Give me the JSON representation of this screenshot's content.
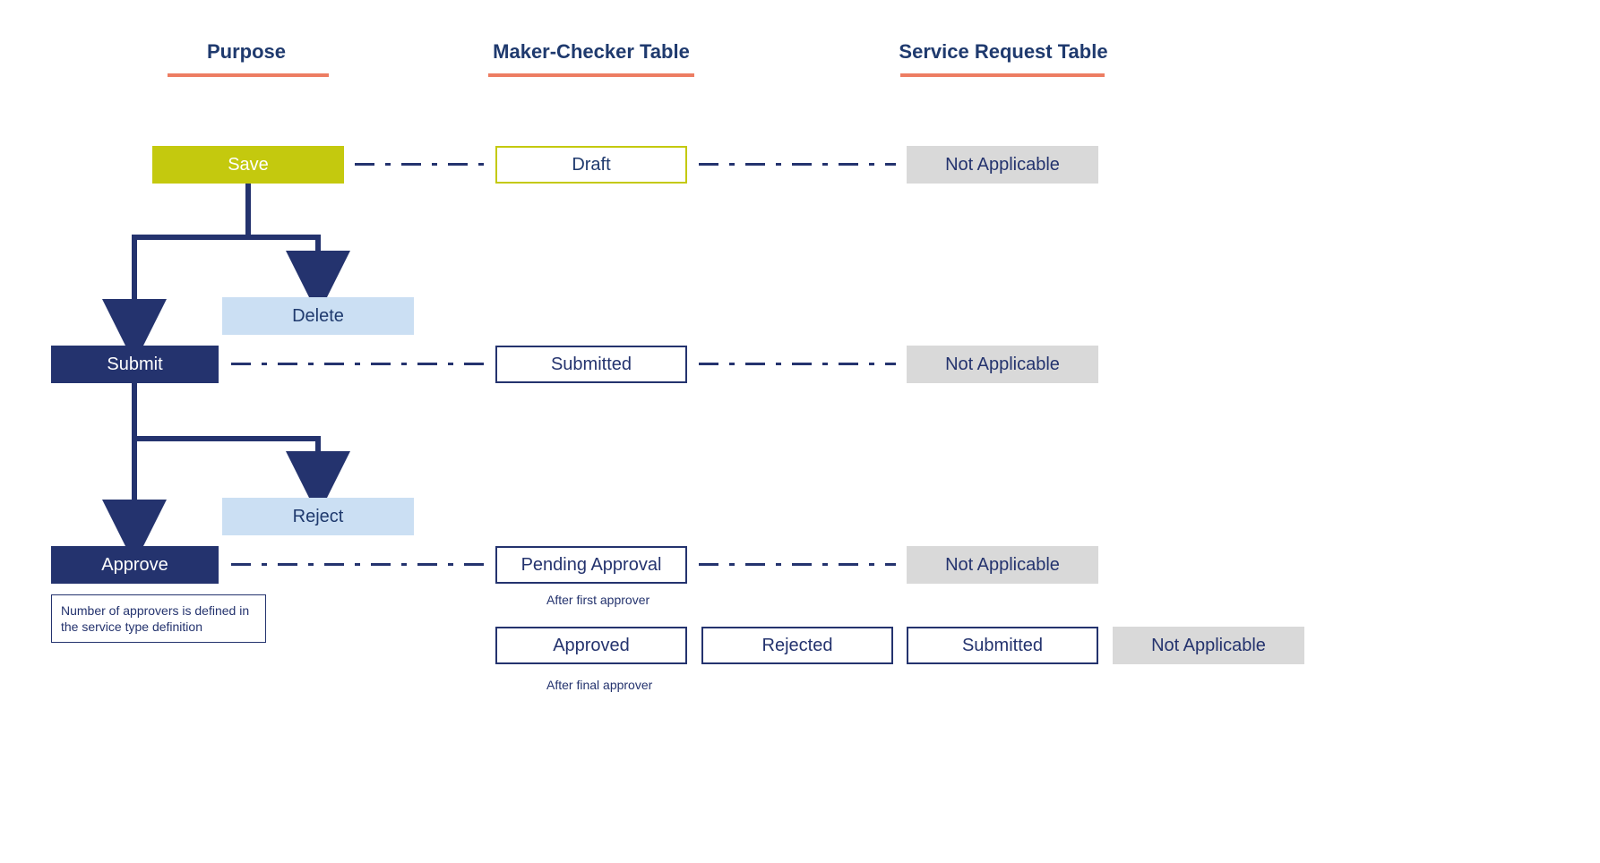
{
  "headings": {
    "purpose": "Purpose",
    "maker_checker": "Maker-Checker Table",
    "service_request": "Service Request Table"
  },
  "purpose": {
    "save": "Save",
    "delete": "Delete",
    "submit": "Submit",
    "reject": "Reject",
    "approve": "Approve",
    "approve_note": "Number of approvers is defined in the service type definition"
  },
  "maker_checker": {
    "draft": "Draft",
    "submitted": "Submitted",
    "pending_approval": "Pending Approval",
    "after_first": "After first approver",
    "approved": "Approved",
    "rejected": "Rejected",
    "after_final": "After final approver"
  },
  "service_request": {
    "na1": "Not Applicable",
    "na2": "Not Applicable",
    "na3": "Not Applicable",
    "submitted": "Submitted",
    "na4": "Not Applicable"
  },
  "colors": {
    "navy": "#24336e",
    "olive": "#c4c90e",
    "coral": "#ed7d62",
    "lightblue": "#cbdff3",
    "grey": "#d9d9d9"
  }
}
